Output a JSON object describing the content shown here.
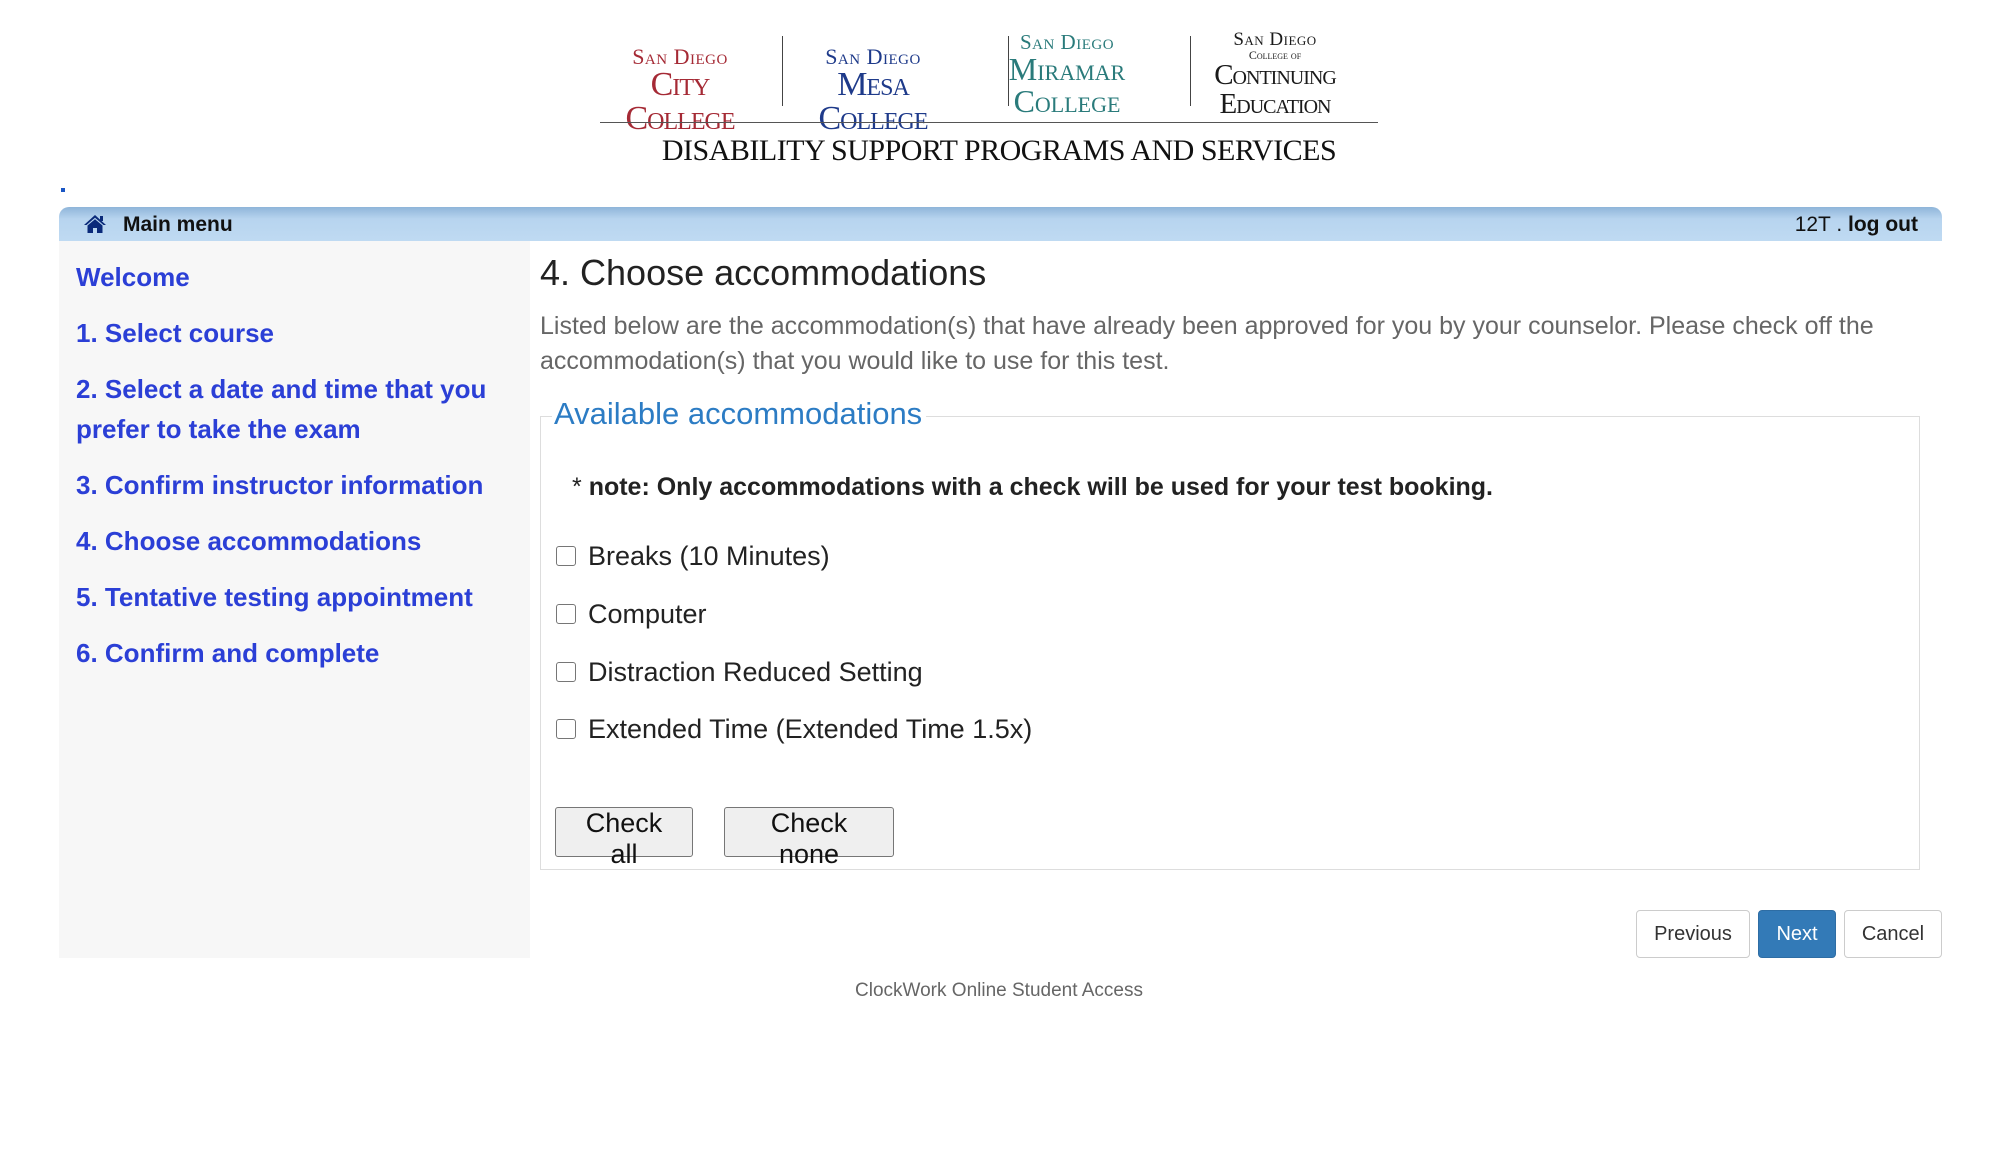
{
  "header": {
    "logos": [
      {
        "small": "San Diego",
        "big": "City College",
        "color": "#a52a35"
      },
      {
        "small": "San Diego",
        "big": "Mesa College",
        "color": "#1e3a8a"
      },
      {
        "small": "San Diego",
        "big1": "Miramar",
        "big2": "College",
        "color": "#2a7b7b"
      },
      {
        "small": "San Diego",
        "tiny": "College of",
        "big1": "Continuing",
        "big2": "Education",
        "color": "#1a1a1a"
      }
    ],
    "title": "DISABILITY SUPPORT PROGRAMS AND SERVICES"
  },
  "topbar": {
    "home_icon": "home-icon",
    "main_menu": "Main menu",
    "user_code": "12T .",
    "logout": "log out"
  },
  "sidebar": {
    "items": [
      {
        "label": "Welcome"
      },
      {
        "label": "1. Select course"
      },
      {
        "label": "2. Select a date and time that you prefer to take the exam"
      },
      {
        "label": "3. Confirm instructor information"
      },
      {
        "label": "4. Choose accommodations"
      },
      {
        "label": "5. Tentative testing appointment"
      },
      {
        "label": "6. Confirm and complete"
      }
    ],
    "link_color": "#2b3fd6"
  },
  "main": {
    "title": "4. Choose accommodations",
    "description": "Listed below are the accommodation(s) that have already been approved for you by your counselor. Please check off the accommodation(s) that you would like to use for this test.",
    "fieldset": {
      "legend": "Available accommodations",
      "note_star": "*",
      "note": "note: Only accommodations with a check will be used for your test booking.",
      "accommodations": [
        {
          "label": "Breaks (10 Minutes)",
          "checked": false
        },
        {
          "label": "Computer",
          "checked": false
        },
        {
          "label": "Distraction Reduced Setting",
          "checked": false
        },
        {
          "label": "Extended Time (Extended Time 1.5x)",
          "checked": false
        }
      ],
      "check_all": "Check all",
      "check_none": "Check none"
    },
    "nav": {
      "previous": "Previous",
      "next": "Next",
      "cancel": "Cancel",
      "primary_color": "#337ab7"
    }
  },
  "footer": {
    "text": "ClockWork Online Student Access"
  }
}
